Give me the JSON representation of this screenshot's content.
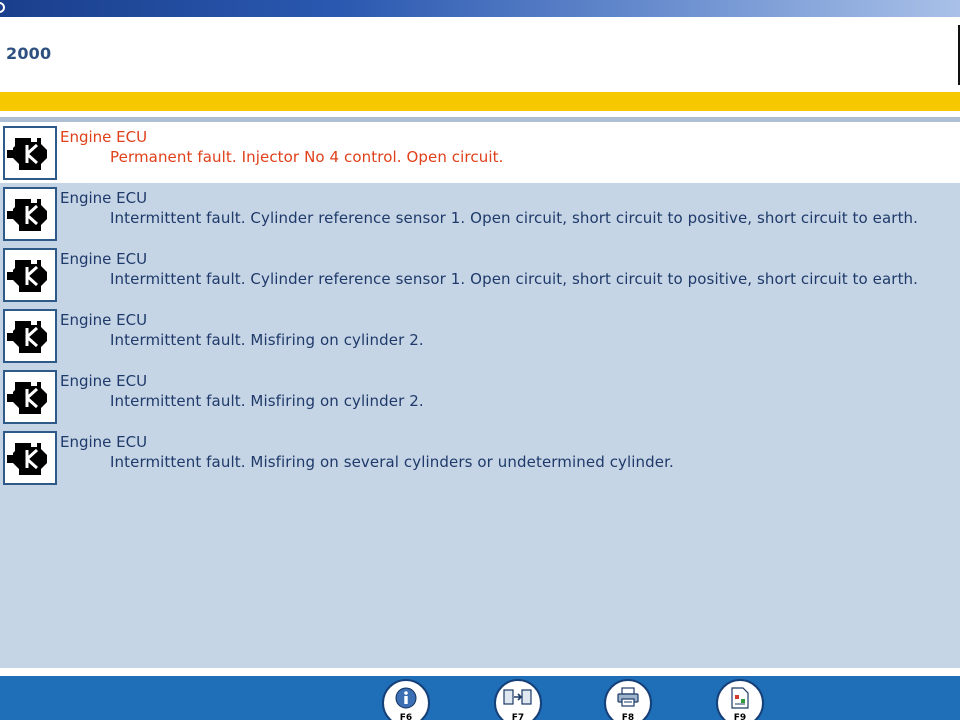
{
  "header": {
    "year": "2000"
  },
  "faults": [
    {
      "icon": "engine-icon",
      "title": "Engine ECU",
      "description": "Permanent fault. Injector No 4 control. Open circuit.",
      "selected": true
    },
    {
      "icon": "engine-icon",
      "title": "Engine ECU",
      "description": "Intermittent fault. Cylinder reference sensor 1. Open circuit, short circuit to positive, short circuit to earth.",
      "selected": false
    },
    {
      "icon": "engine-icon",
      "title": "Engine ECU",
      "description": "Intermittent fault. Cylinder reference sensor 1. Open circuit, short circuit to positive, short circuit to earth.",
      "selected": false
    },
    {
      "icon": "engine-icon",
      "title": "Engine ECU",
      "description": "Intermittent fault. Misfiring on cylinder 2.",
      "selected": false
    },
    {
      "icon": "engine-icon",
      "title": "Engine ECU",
      "description": "Intermittent fault. Misfiring on cylinder 2.",
      "selected": false
    },
    {
      "icon": "engine-icon",
      "title": "Engine ECU",
      "description": "Intermittent fault. Misfiring on several cylinders or undetermined cylinder.",
      "selected": false
    }
  ],
  "footer": {
    "keys": [
      {
        "label": "F6",
        "icon": "info-icon"
      },
      {
        "label": "F7",
        "icon": "exit-icon"
      },
      {
        "label": "F8",
        "icon": "print-icon"
      },
      {
        "label": "F9",
        "icon": "report-icon"
      }
    ]
  },
  "colors": {
    "selected_text": "#e0401a",
    "normal_text": "#1f3a6a",
    "list_background": "#c5d5e5",
    "yellow_band": "#f6c800",
    "footer_blue": "#1f6fb8"
  }
}
